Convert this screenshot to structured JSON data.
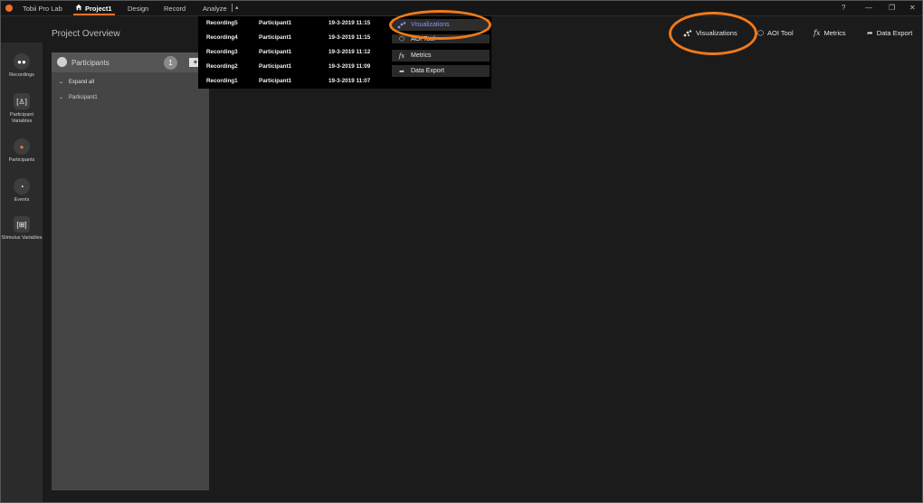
{
  "app": {
    "title": "Tobii Pro Lab",
    "menus": [
      "Project1",
      "Design",
      "Record",
      "Analyze"
    ],
    "analyze_caret": "▴"
  },
  "window_controls": {
    "help": "?",
    "minimize": "—",
    "restore": "❐",
    "close": "✕"
  },
  "page_title": "Project Overview",
  "toolbar": [
    {
      "label": "Visualizations",
      "icon": "scatter-icon"
    },
    {
      "label": "AOI Tool",
      "icon": "aoi-icon"
    },
    {
      "label": "Metrics",
      "icon": "fx-icon"
    },
    {
      "label": "Data Export",
      "icon": "share-arrow-icon"
    }
  ],
  "sidebar": {
    "items": [
      {
        "label": "Recordings",
        "icon": "recordings-icon"
      },
      {
        "label": "Participant Variables",
        "icon": "participant-variables-icon"
      },
      {
        "label": "Participants",
        "icon": "participants-icon"
      },
      {
        "label": "Events",
        "icon": "events-icon"
      },
      {
        "label": "Stimulus Variables",
        "icon": "stimulus-variables-icon"
      }
    ]
  },
  "participants_panel": {
    "title": "Participants",
    "count": "1",
    "add_label": "+",
    "expand_all": "Expand all",
    "participant": "Participant1"
  },
  "recordings": [
    {
      "name": "Recording5",
      "participant": "Participant1",
      "date": "19-3-2019 11:15"
    },
    {
      "name": "Recording4",
      "participant": "Participant1",
      "date": "19-3-2019 11:15"
    },
    {
      "name": "Recording3",
      "participant": "Participant1",
      "date": "19-3-2019 11:12"
    },
    {
      "name": "Recording2",
      "participant": "Participant1",
      "date": "19-3-2019 11:09"
    },
    {
      "name": "Recording1",
      "participant": "Participant1",
      "date": "19-3-2019 11:07"
    }
  ],
  "analyze_menu": [
    {
      "label": "Visualizations",
      "icon": "scatter-icon",
      "selected": true
    },
    {
      "label": "AOI Tool",
      "icon": "aoi-icon"
    },
    {
      "label": "Metrics",
      "icon": "fx-icon"
    },
    {
      "label": "Data Export",
      "icon": "share-arrow-icon"
    }
  ],
  "colors": {
    "accent": "#e8702a",
    "selected_text": "#8c93ff",
    "annotation": "#f07a1a"
  }
}
